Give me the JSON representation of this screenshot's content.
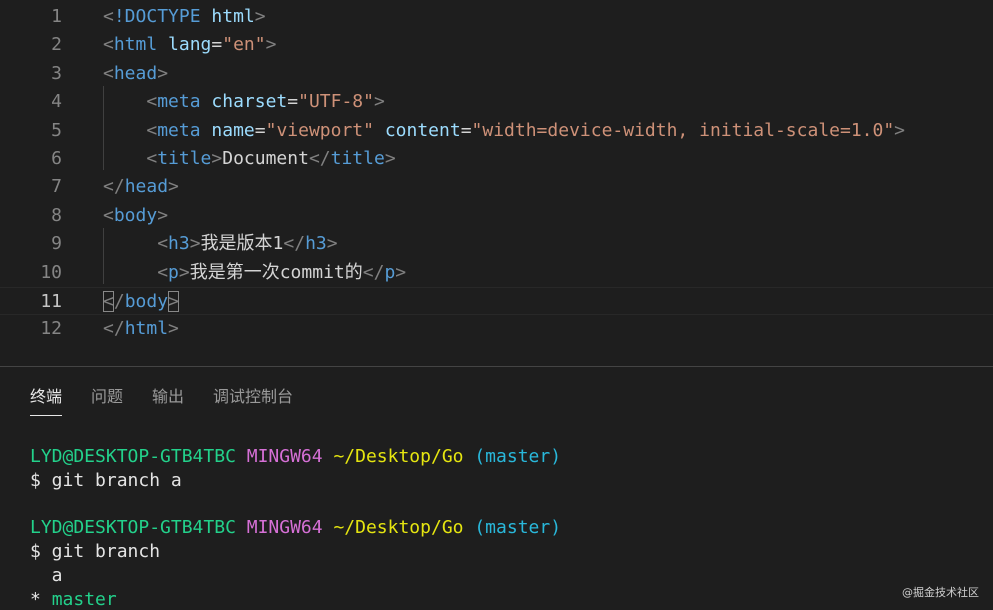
{
  "editor": {
    "current_line": 11,
    "lines": [
      {
        "n": "1",
        "tokens": [
          {
            "t": "<",
            "c": "bracket"
          },
          {
            "t": "!DOCTYPE",
            "c": "tag"
          },
          {
            "t": " ",
            "c": "text"
          },
          {
            "t": "html",
            "c": "attr"
          },
          {
            "t": ">",
            "c": "bracket"
          }
        ]
      },
      {
        "n": "2",
        "tokens": [
          {
            "t": "<",
            "c": "bracket"
          },
          {
            "t": "html",
            "c": "tag"
          },
          {
            "t": " ",
            "c": "text"
          },
          {
            "t": "lang",
            "c": "attr"
          },
          {
            "t": "=",
            "c": "eq"
          },
          {
            "t": "\"en\"",
            "c": "str"
          },
          {
            "t": ">",
            "c": "bracket"
          }
        ]
      },
      {
        "n": "3",
        "tokens": [
          {
            "t": "<",
            "c": "bracket"
          },
          {
            "t": "head",
            "c": "tag"
          },
          {
            "t": ">",
            "c": "bracket"
          }
        ]
      },
      {
        "n": "4",
        "tokens": [
          {
            "t": "    ",
            "c": "text"
          },
          {
            "t": "<",
            "c": "bracket"
          },
          {
            "t": "meta",
            "c": "tag"
          },
          {
            "t": " ",
            "c": "text"
          },
          {
            "t": "charset",
            "c": "attr"
          },
          {
            "t": "=",
            "c": "eq"
          },
          {
            "t": "\"UTF-8\"",
            "c": "str"
          },
          {
            "t": ">",
            "c": "bracket"
          }
        ]
      },
      {
        "n": "5",
        "tokens": [
          {
            "t": "    ",
            "c": "text"
          },
          {
            "t": "<",
            "c": "bracket"
          },
          {
            "t": "meta",
            "c": "tag"
          },
          {
            "t": " ",
            "c": "text"
          },
          {
            "t": "name",
            "c": "attr"
          },
          {
            "t": "=",
            "c": "eq"
          },
          {
            "t": "\"viewport\"",
            "c": "str"
          },
          {
            "t": " ",
            "c": "text"
          },
          {
            "t": "content",
            "c": "attr"
          },
          {
            "t": "=",
            "c": "eq"
          },
          {
            "t": "\"width=device-width, initial-scale=1.0\"",
            "c": "str"
          },
          {
            "t": ">",
            "c": "bracket"
          }
        ]
      },
      {
        "n": "6",
        "tokens": [
          {
            "t": "    ",
            "c": "text"
          },
          {
            "t": "<",
            "c": "bracket"
          },
          {
            "t": "title",
            "c": "tag"
          },
          {
            "t": ">",
            "c": "bracket"
          },
          {
            "t": "Document",
            "c": "text"
          },
          {
            "t": "</",
            "c": "bracket"
          },
          {
            "t": "title",
            "c": "tag"
          },
          {
            "t": ">",
            "c": "bracket"
          }
        ]
      },
      {
        "n": "7",
        "tokens": [
          {
            "t": "</",
            "c": "bracket"
          },
          {
            "t": "head",
            "c": "tag"
          },
          {
            "t": ">",
            "c": "bracket"
          }
        ]
      },
      {
        "n": "8",
        "tokens": [
          {
            "t": "<",
            "c": "bracket"
          },
          {
            "t": "body",
            "c": "tag"
          },
          {
            "t": ">",
            "c": "bracket"
          }
        ]
      },
      {
        "n": "9",
        "tokens": [
          {
            "t": "     ",
            "c": "text"
          },
          {
            "t": "<",
            "c": "bracket"
          },
          {
            "t": "h3",
            "c": "tag"
          },
          {
            "t": ">",
            "c": "bracket"
          },
          {
            "t": "我是版本1",
            "c": "text"
          },
          {
            "t": "</",
            "c": "bracket"
          },
          {
            "t": "h3",
            "c": "tag"
          },
          {
            "t": ">",
            "c": "bracket"
          }
        ]
      },
      {
        "n": "10",
        "tokens": [
          {
            "t": "     ",
            "c": "text"
          },
          {
            "t": "<",
            "c": "bracket"
          },
          {
            "t": "p",
            "c": "tag"
          },
          {
            "t": ">",
            "c": "bracket"
          },
          {
            "t": "我是第一次commit的",
            "c": "text"
          },
          {
            "t": "</",
            "c": "bracket"
          },
          {
            "t": "p",
            "c": "tag"
          },
          {
            "t": ">",
            "c": "bracket"
          }
        ]
      },
      {
        "n": "11",
        "tokens": [
          {
            "t": "<",
            "c": "bracket",
            "match": true
          },
          {
            "t": "/",
            "c": "bracket"
          },
          {
            "t": "body",
            "c": "tag"
          },
          {
            "t": ">",
            "c": "bracket",
            "match": true
          }
        ]
      },
      {
        "n": "12",
        "tokens": [
          {
            "t": "</",
            "c": "bracket"
          },
          {
            "t": "html",
            "c": "tag"
          },
          {
            "t": ">",
            "c": "bracket"
          }
        ]
      }
    ]
  },
  "panel": {
    "tabs": [
      {
        "label": "终端",
        "active": true
      },
      {
        "label": "问题",
        "active": false
      },
      {
        "label": "输出",
        "active": false
      },
      {
        "label": "调试控制台",
        "active": false
      }
    ]
  },
  "terminal": {
    "lines": [
      {
        "segments": [
          {
            "t": "LYD@DESKTOP-GTB4TBC",
            "c": "green"
          },
          {
            "t": " ",
            "c": "white"
          },
          {
            "t": "MINGW64",
            "c": "magenta"
          },
          {
            "t": " ",
            "c": "white"
          },
          {
            "t": "~/Desktop/Go",
            "c": "yellow"
          },
          {
            "t": " ",
            "c": "white"
          },
          {
            "t": "(master)",
            "c": "cyan"
          }
        ]
      },
      {
        "segments": [
          {
            "t": "$ git branch a",
            "c": "white"
          }
        ]
      },
      {
        "gap": true
      },
      {
        "segments": [
          {
            "t": "LYD@DESKTOP-GTB4TBC",
            "c": "green"
          },
          {
            "t": " ",
            "c": "white"
          },
          {
            "t": "MINGW64",
            "c": "magenta"
          },
          {
            "t": " ",
            "c": "white"
          },
          {
            "t": "~/Desktop/Go",
            "c": "yellow"
          },
          {
            "t": " ",
            "c": "white"
          },
          {
            "t": "(master)",
            "c": "cyan"
          }
        ]
      },
      {
        "segments": [
          {
            "t": "$ git branch",
            "c": "white"
          }
        ]
      },
      {
        "segments": [
          {
            "t": "  a",
            "c": "white"
          }
        ]
      },
      {
        "segments": [
          {
            "t": "* ",
            "c": "white"
          },
          {
            "t": "master",
            "c": "green"
          }
        ]
      }
    ]
  },
  "watermark": "@掘金技术社区"
}
